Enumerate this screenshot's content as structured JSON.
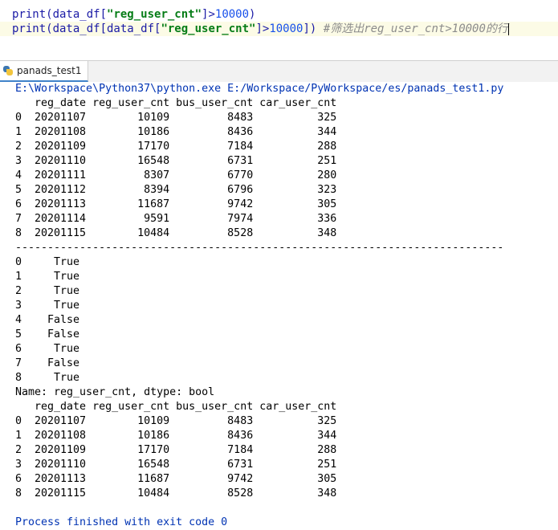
{
  "editor": {
    "line1": {
      "prefix": "print(data_df[",
      "str": "\"reg_user_cnt\"",
      "suffix": "]>",
      "num": "10000",
      "close": ")"
    },
    "line2": {
      "prefix": "print(data_df[data_df[",
      "str": "\"reg_user_cnt\"",
      "suffix": "]>",
      "num": "10000",
      "close": "]) ",
      "comment": "#筛选出reg_user_cnt>10000的行"
    }
  },
  "run_tab": {
    "label": "panads_test1",
    "icon": "python-icon"
  },
  "console": {
    "command": "E:\\Workspace\\Python37\\python.exe E:/Workspace/PyWorkspace/es/panads_test1.py",
    "lines": [
      "   reg_date reg_user_cnt bus_user_cnt car_user_cnt",
      "0  20201107        10109         8483          325",
      "1  20201108        10186         8436          344",
      "2  20201109        17170         7184          288",
      "3  20201110        16548         6731          251",
      "4  20201111         8307         6770          280",
      "5  20201112         8394         6796          323",
      "6  20201113        11687         9742          305",
      "7  20201114         9591         7974          336",
      "8  20201115        10484         8528          348",
      "----------------------------------------------------------------------------",
      "0     True",
      "1     True",
      "2     True",
      "3     True",
      "4    False",
      "5    False",
      "6     True",
      "7    False",
      "8     True",
      "Name: reg_user_cnt, dtype: bool",
      "   reg_date reg_user_cnt bus_user_cnt car_user_cnt",
      "0  20201107        10109         8483          325",
      "1  20201108        10186         8436          344",
      "2  20201109        17170         7184          288",
      "3  20201110        16548         6731          251",
      "6  20201113        11687         9742          305",
      "8  20201115        10484         8528          348"
    ],
    "finished": "Process finished with exit code 0"
  }
}
